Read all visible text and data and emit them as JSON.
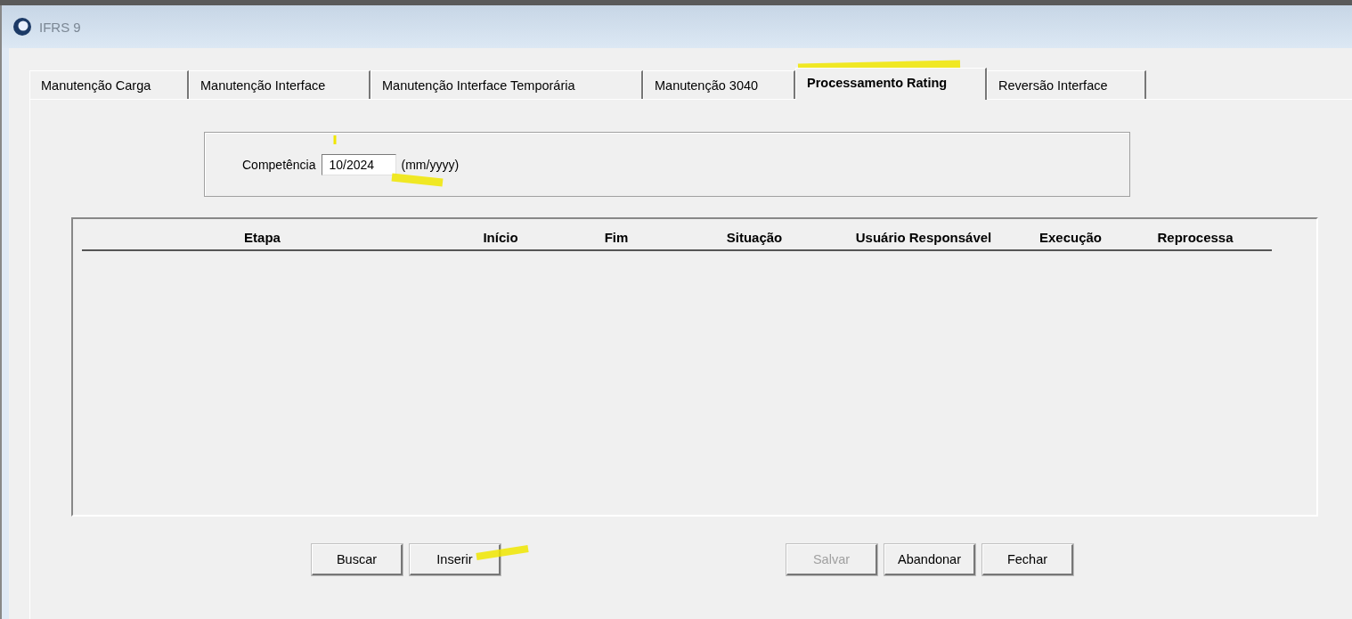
{
  "window": {
    "title": "IFRS 9"
  },
  "tabs": [
    {
      "label": "Manutenção Carga",
      "selected": false
    },
    {
      "label": "Manutenção Interface",
      "selected": false
    },
    {
      "label": "Manutenção Interface Temporária",
      "selected": false
    },
    {
      "label": "Manutenção 3040",
      "selected": false
    },
    {
      "label": "Processamento Rating",
      "selected": true
    },
    {
      "label": "Reversão Interface",
      "selected": false
    }
  ],
  "filter": {
    "label": "Competência",
    "value": "10/2024",
    "hint": "(mm/yyyy)"
  },
  "table": {
    "columns": [
      "Etapa",
      "Início",
      "Fim",
      "Situação",
      "Usuário Responsável",
      "Execução",
      "Reprocessa"
    ]
  },
  "buttons": [
    {
      "label": "Buscar",
      "disabled": false
    },
    {
      "label": "Inserir",
      "disabled": false
    },
    {
      "label": "Salvar",
      "disabled": true
    },
    {
      "label": "Abandonar",
      "disabled": false
    },
    {
      "label": "Fechar",
      "disabled": false
    }
  ]
}
